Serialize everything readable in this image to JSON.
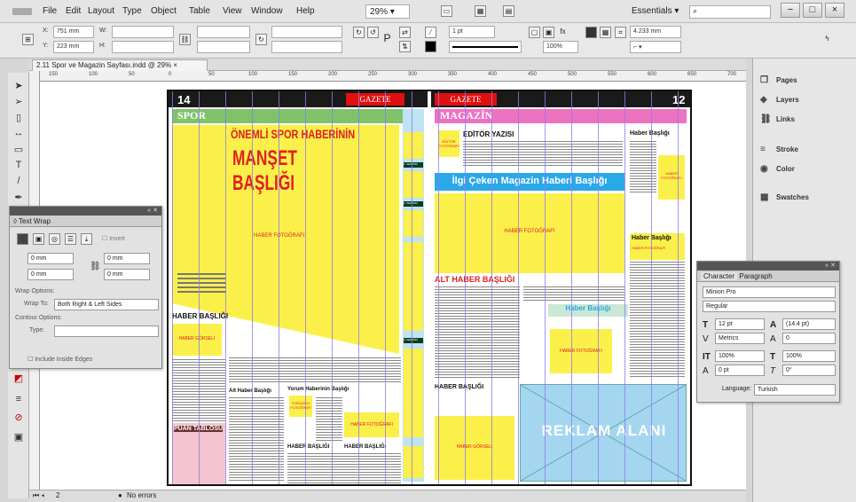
{
  "menubar": {
    "items": [
      "File",
      "Edit",
      "Layout",
      "Type",
      "Object",
      "Table",
      "View",
      "Window",
      "Help"
    ],
    "zoom": "29%",
    "workspace": "Essentials",
    "win_min": "−",
    "win_max": "□",
    "win_close": "×"
  },
  "control": {
    "x_label": "X:",
    "x_value": "751 mm",
    "y_label": "Y:",
    "y_value": "223 mm",
    "w_label": "W:",
    "h_label": "H:",
    "stroke_weight": "1 pt",
    "scale": "100%",
    "size_value": "4.233 mm"
  },
  "document": {
    "tab_title": "2.11 Spor ve Magazin Sayfası.indd @ 29%",
    "tab_close": "×",
    "ruler_labels": [
      "150",
      "100",
      "50",
      "0",
      "50",
      "100",
      "150",
      "200",
      "250",
      "300",
      "350",
      "400",
      "450",
      "500",
      "550",
      "600",
      "650",
      "700"
    ]
  },
  "status": {
    "page": "2",
    "errors": "No errors"
  },
  "left_page": {
    "page_num": "14",
    "logo": "GAZETE LOGOSU",
    "section": "SPOR",
    "headline1": "ÖNEMLİ SPOR HABERİNİN",
    "headline2": "MANŞET BAŞLIĞI",
    "photo_main": "HABER FOTOĞRAFI",
    "side_gorsel": "HABER GÖRSELİ",
    "side_titles": [
      "HABER BAŞLIĞI",
      "HABER GÖRSELİ"
    ],
    "news_title": "HABER BAŞLIĞI",
    "news_photo": "HABER GÖRSELİ",
    "points_table": "PUAN TABLOSU",
    "alt_title": "Alt Haber Başlığı",
    "yorum_title": "Yorum Haberinin Başlığı",
    "yorum_photo": "YORUMCU FOTOĞRAFI",
    "photo_small": "HABER FOTOĞRAFI",
    "bottom_titles": [
      "HABER BAŞLIĞI",
      "HABER BAŞLIĞI"
    ],
    "strip_labels": [
      "1. SEKTÖR",
      "2. SEKTÖR",
      "3. SEKTÖR"
    ]
  },
  "right_page": {
    "page_num": "12",
    "logo": "GAZETE LOGOSU",
    "section": "MAGAZİN",
    "editor_title": "EDİTÖR YAZISI",
    "editor_photo": "EDİTÖR FOTOĞRAFI",
    "headline": "İlgi Çeken Magazin Haberi Başlığı",
    "photo_main": "HABER FOTOĞRAFI",
    "right_titles": [
      "Haber Başlığı",
      "Haber Başlığı"
    ],
    "right_photo": "HABER FOTOĞRAFI",
    "right_photo2": "HABER FOTOĞRAFI",
    "alt_title": "ALT HABER BAŞLIĞI",
    "center_title": "Haber Başlığı",
    "center_photo": "HABER FOTOĞRAFI",
    "news_title": "HABER BAŞLIĞI",
    "news_gorsel": "HABER GÖRSELİ",
    "ad": "REKLAM ALANI"
  },
  "right_panels": {
    "items": [
      "Pages",
      "Layers",
      "Links",
      "Stroke",
      "Color",
      "Swatches"
    ]
  },
  "text_wrap": {
    "title": "Text Wrap",
    "invert": "Invert",
    "top": "0 mm",
    "bottom": "0 mm",
    "left": "0 mm",
    "right": "0 mm",
    "wrap_options": "Wrap Options:",
    "wrap_to_label": "Wrap To:",
    "wrap_to": "Both Right & Left Sides",
    "contour": "Contour Options:",
    "type_label": "Type:",
    "include_edges": "Include Inside Edges"
  },
  "character": {
    "tab1": "Character",
    "tab2": "Paragraph",
    "font": "Minion Pro",
    "style": "Regular",
    "size": "12 pt",
    "leading": "(14.4 pt)",
    "kerning": "Metrics",
    "tracking": "0",
    "vscale": "100%",
    "hscale": "100%",
    "baseline": "0 pt",
    "skew": "0°",
    "language_label": "Language:",
    "language": "Turkish"
  }
}
